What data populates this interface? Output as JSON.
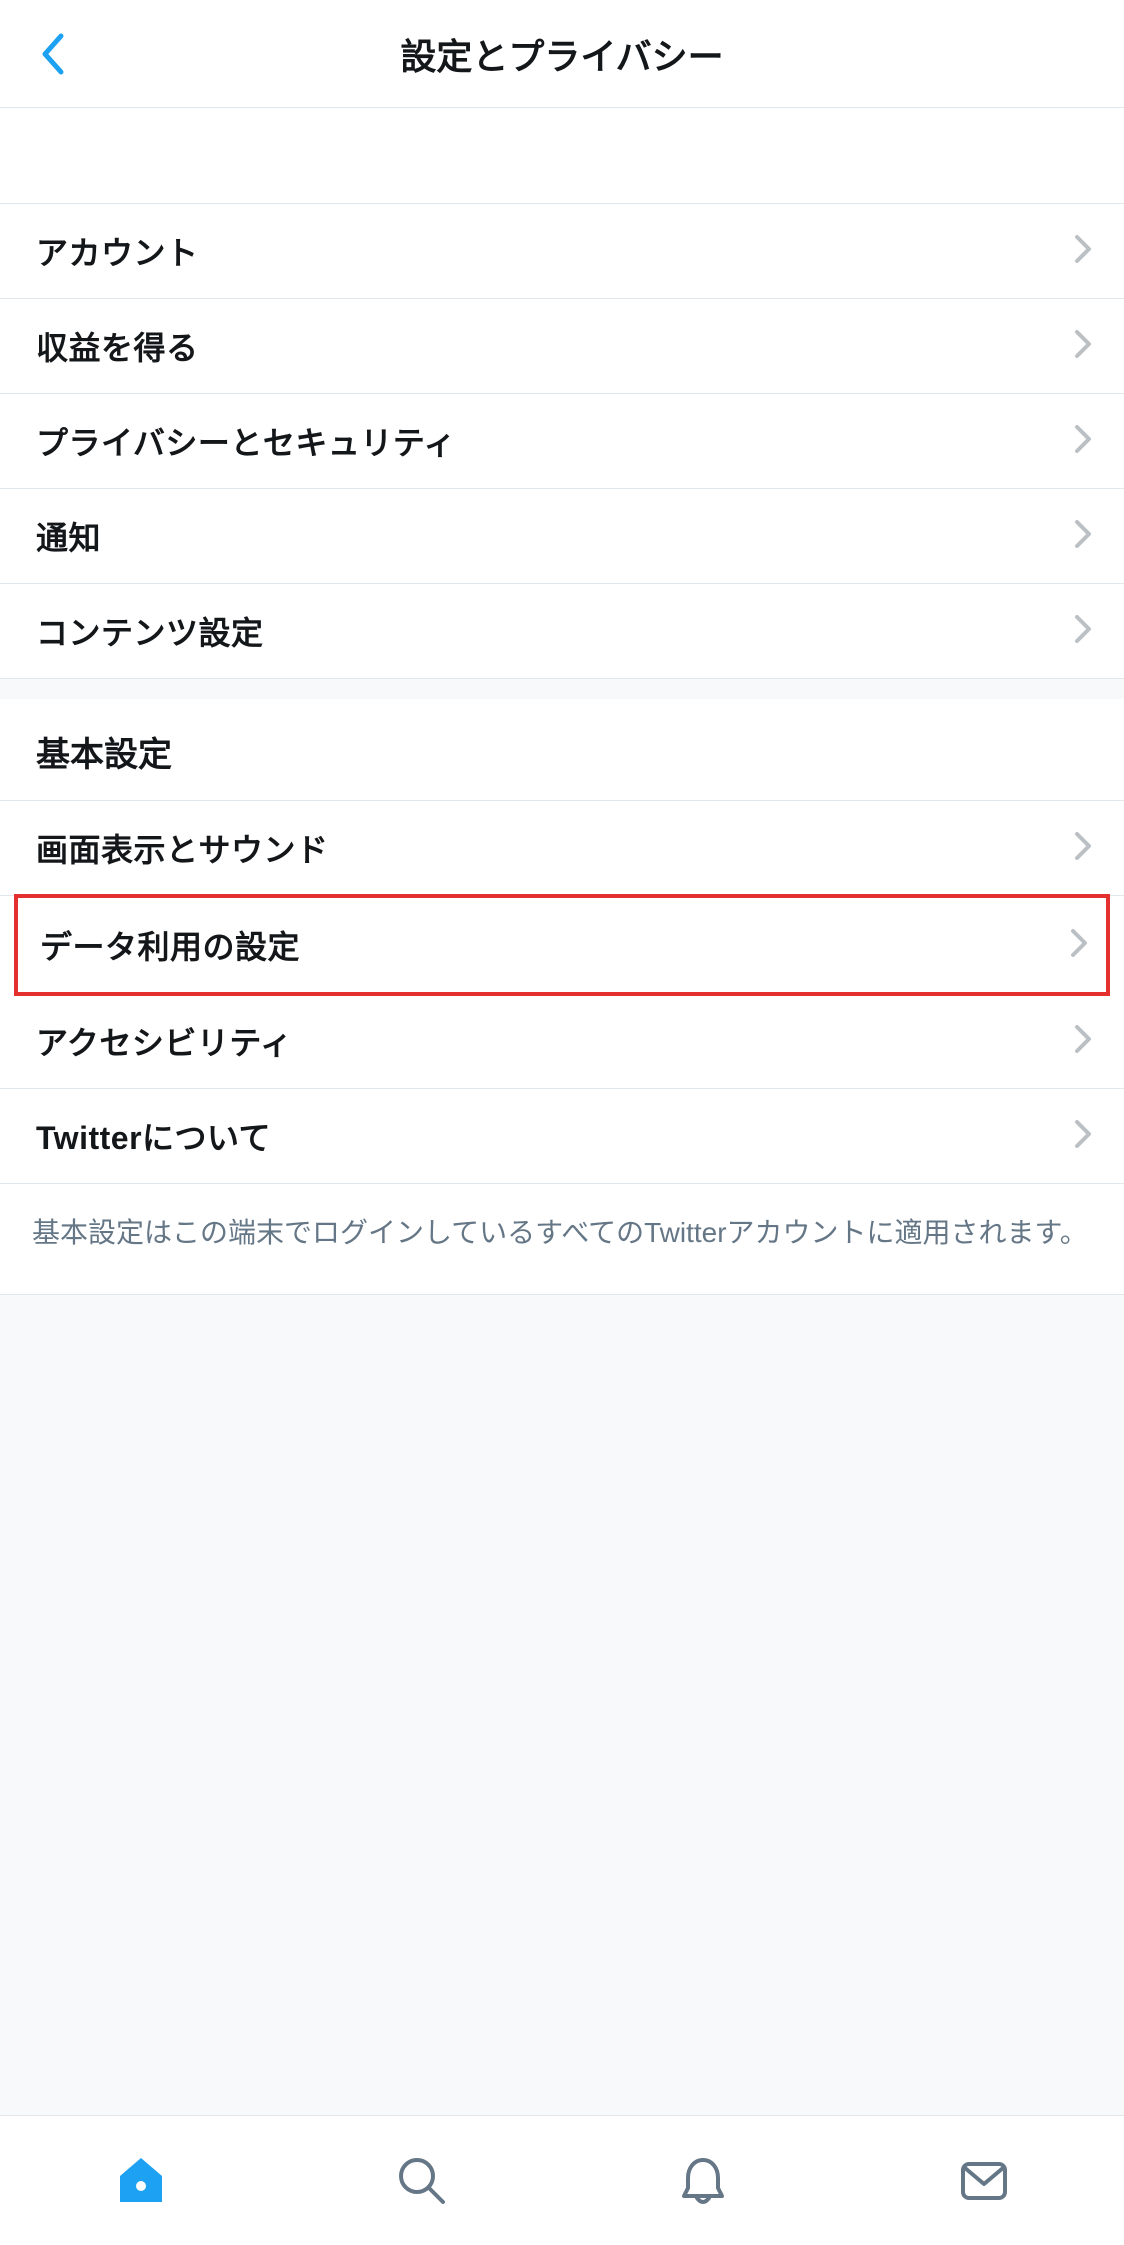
{
  "header": {
    "title": "設定とプライバシー"
  },
  "sections": {
    "top": {
      "items": [
        {
          "label": "アカウント"
        },
        {
          "label": "収益を得る"
        },
        {
          "label": "プライバシーとセキュリティ"
        },
        {
          "label": "通知"
        },
        {
          "label": "コンテンツ設定"
        }
      ]
    },
    "general": {
      "title": "基本設定",
      "items": [
        {
          "label": "画面表示とサウンド"
        },
        {
          "label": "データ利用の設定"
        },
        {
          "label": "アクセシビリティ"
        },
        {
          "label": "Twitterについて"
        }
      ],
      "note": "基本設定はこの端末でログインしているすべてのTwitterアカウントに適用されます。"
    }
  },
  "colors": {
    "accent": "#1da1f2",
    "highlight": "#e53030",
    "chevron": "#bbc0c4",
    "textGray": "#657786"
  }
}
